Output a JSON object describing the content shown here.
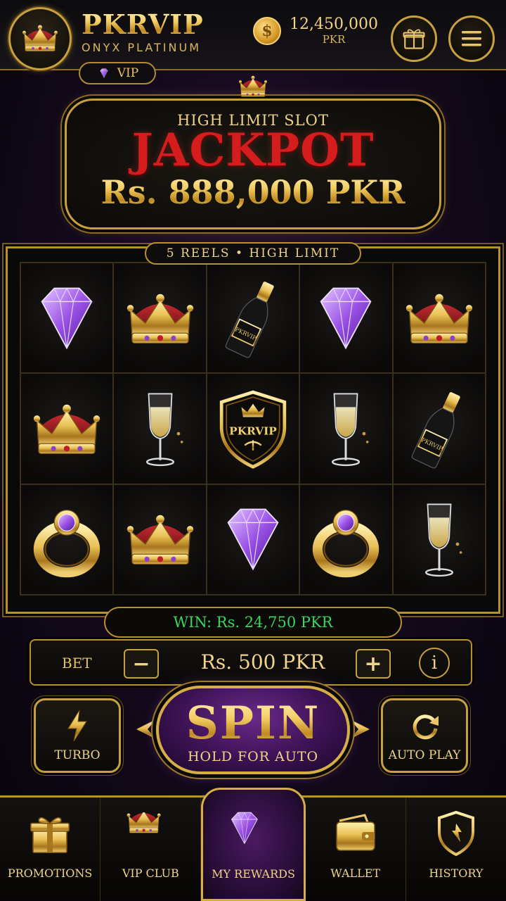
{
  "header": {
    "brand_name": "PKRVIP",
    "brand_sub": "ONYX PLATINUM",
    "vip_label": "VIP",
    "balance_amount": "12,450,000",
    "balance_currency": "PKR",
    "coin_symbol": "$"
  },
  "jackpot": {
    "label": "HIGH LIMIT SLOT",
    "title": "JACKPOT",
    "amount": "Rs. 888,000 PKR"
  },
  "reels": {
    "tag": "5 REELS • HIGH LIMIT",
    "shield_text": "PKRVIP",
    "bottle_text": "PKRVIP",
    "symbols": [
      [
        "diamond",
        "crown",
        "champagne-bottle",
        "diamond",
        "crown"
      ],
      [
        "crown",
        "champagne-glass",
        "pkrvip-shield",
        "champagne-glass",
        "champagne-bottle"
      ],
      [
        "ring",
        "crown",
        "diamond",
        "ring",
        "champagne-glass"
      ]
    ]
  },
  "win": {
    "text": "WIN: Rs. 24,750 PKR"
  },
  "bet": {
    "label": "BET",
    "value": "Rs. 500 PKR",
    "minus": "−",
    "plus": "+",
    "info": "i"
  },
  "controls": {
    "turbo_label": "TURBO",
    "spin_label": "SPIN",
    "spin_sub": "HOLD FOR AUTO",
    "autoplay_label": "AUTO PLAY"
  },
  "nav": {
    "items": [
      {
        "label": "PROMOTIONS",
        "icon": "gift-icon"
      },
      {
        "label": "VIP CLUB",
        "icon": "crown-icon"
      },
      {
        "label": "MY REWARDS",
        "icon": "diamond-icon",
        "active": true
      },
      {
        "label": "WALLET",
        "icon": "wallet-icon"
      },
      {
        "label": "HISTORY",
        "icon": "shield-icon"
      }
    ]
  },
  "colors": {
    "gold": "#c9a040",
    "jackpot_red": "#d61d1d",
    "win_green": "#39d65b",
    "spin_purple": "#3c1254"
  }
}
